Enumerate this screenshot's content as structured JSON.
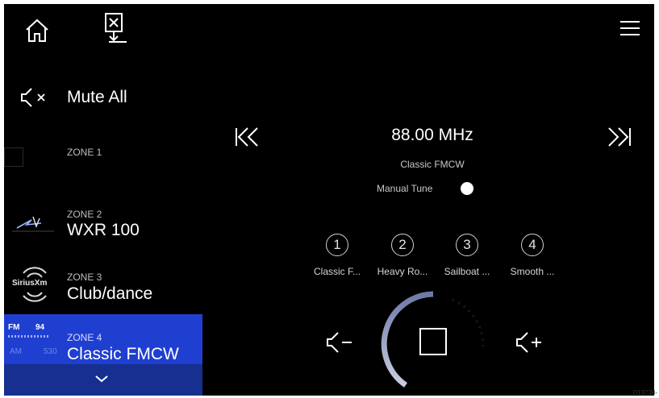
{
  "topbar": {
    "home_icon": "home-icon",
    "exit_icon": "exit-icon",
    "menu_icon": "hamburger-menu-icon"
  },
  "sidebar": {
    "mute_all_label": "Mute All",
    "zones": [
      {
        "name": "ZONE 1",
        "source": ""
      },
      {
        "name": "ZONE 2",
        "source": "WXR 100"
      },
      {
        "name": "ZONE 3",
        "source": "Club/dance",
        "logo": "SiriusXm"
      },
      {
        "name": "ZONE 4",
        "source": "Classic FMCW",
        "band_fm": "FM",
        "band_am": "AM",
        "freq_fm": "94",
        "freq_am": "530"
      }
    ],
    "more_icon": "chevron-down-icon",
    "active_color": "#1f3fd1"
  },
  "tuner": {
    "frequency": "88.00 MHz",
    "station": "Classic FMCW",
    "manual_tune_label": "Manual Tune",
    "prev_icon": "skip-back-icon",
    "next_icon": "skip-forward-icon"
  },
  "presets": [
    {
      "num": "1",
      "name": "Classic F..."
    },
    {
      "num": "2",
      "name": "Heavy Ro..."
    },
    {
      "num": "3",
      "name": "Sailboat ..."
    },
    {
      "num": "4",
      "name": "Smooth ..."
    }
  ],
  "controls": {
    "vol_down_icon": "volume-down-icon",
    "stop_icon": "stop-icon",
    "vol_up_icon": "volume-up-icon"
  },
  "ref_code": "D13738-"
}
